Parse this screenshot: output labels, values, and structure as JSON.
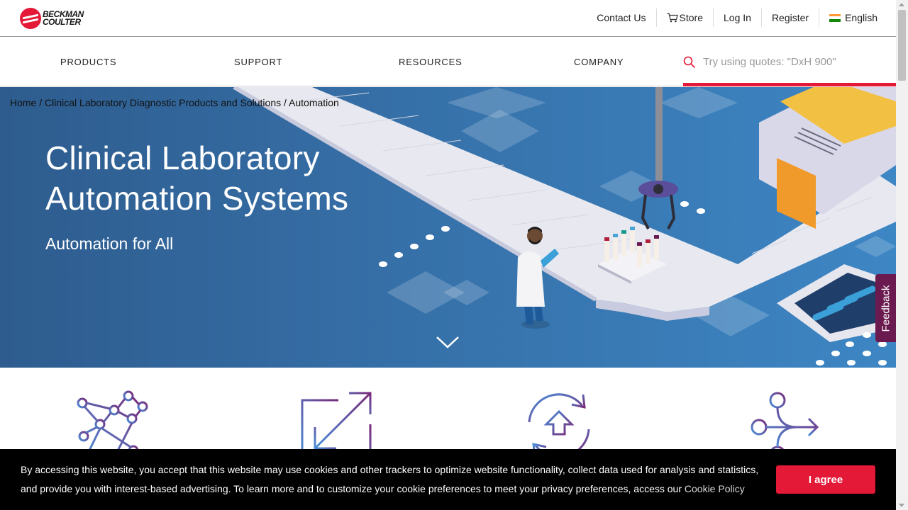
{
  "brand": {
    "logo_line1": "BECKMAN",
    "logo_line2": "COULTER",
    "color": "#e31937"
  },
  "utility": {
    "contact": "Contact Us",
    "store": "Store",
    "login": "Log In",
    "register": "Register",
    "language": "English"
  },
  "nav": {
    "products": "PRODUCTS",
    "support": "SUPPORT",
    "resources": "RESOURCES",
    "company": "COMPANY"
  },
  "search": {
    "placeholder": "Try using quotes: \"DxH 900\""
  },
  "breadcrumb": {
    "home": "Home",
    "sep": "/",
    "category": "Clinical Laboratory Diagnostic Products and Solutions",
    "current": "Automation"
  },
  "hero": {
    "title_line1": "Clinical Laboratory",
    "title_line2": "Automation Systems",
    "subtitle": "Automation for All"
  },
  "feedback": "Feedback",
  "cookie": {
    "message": "By accessing this website, you accept that this website may use cookies and other trackers to optimize website functionality, collect data used for analysis and statistics, and provide you with interest-based advertising. To learn more and to customize your cookie preferences to meet your privacy preferences, access our",
    "policy_link": "Cookie Policy",
    "agree": "I agree"
  },
  "icons": [
    "network-icon",
    "expand-arrows-icon",
    "refresh-cycle-icon",
    "branch-arrow-icon"
  ]
}
